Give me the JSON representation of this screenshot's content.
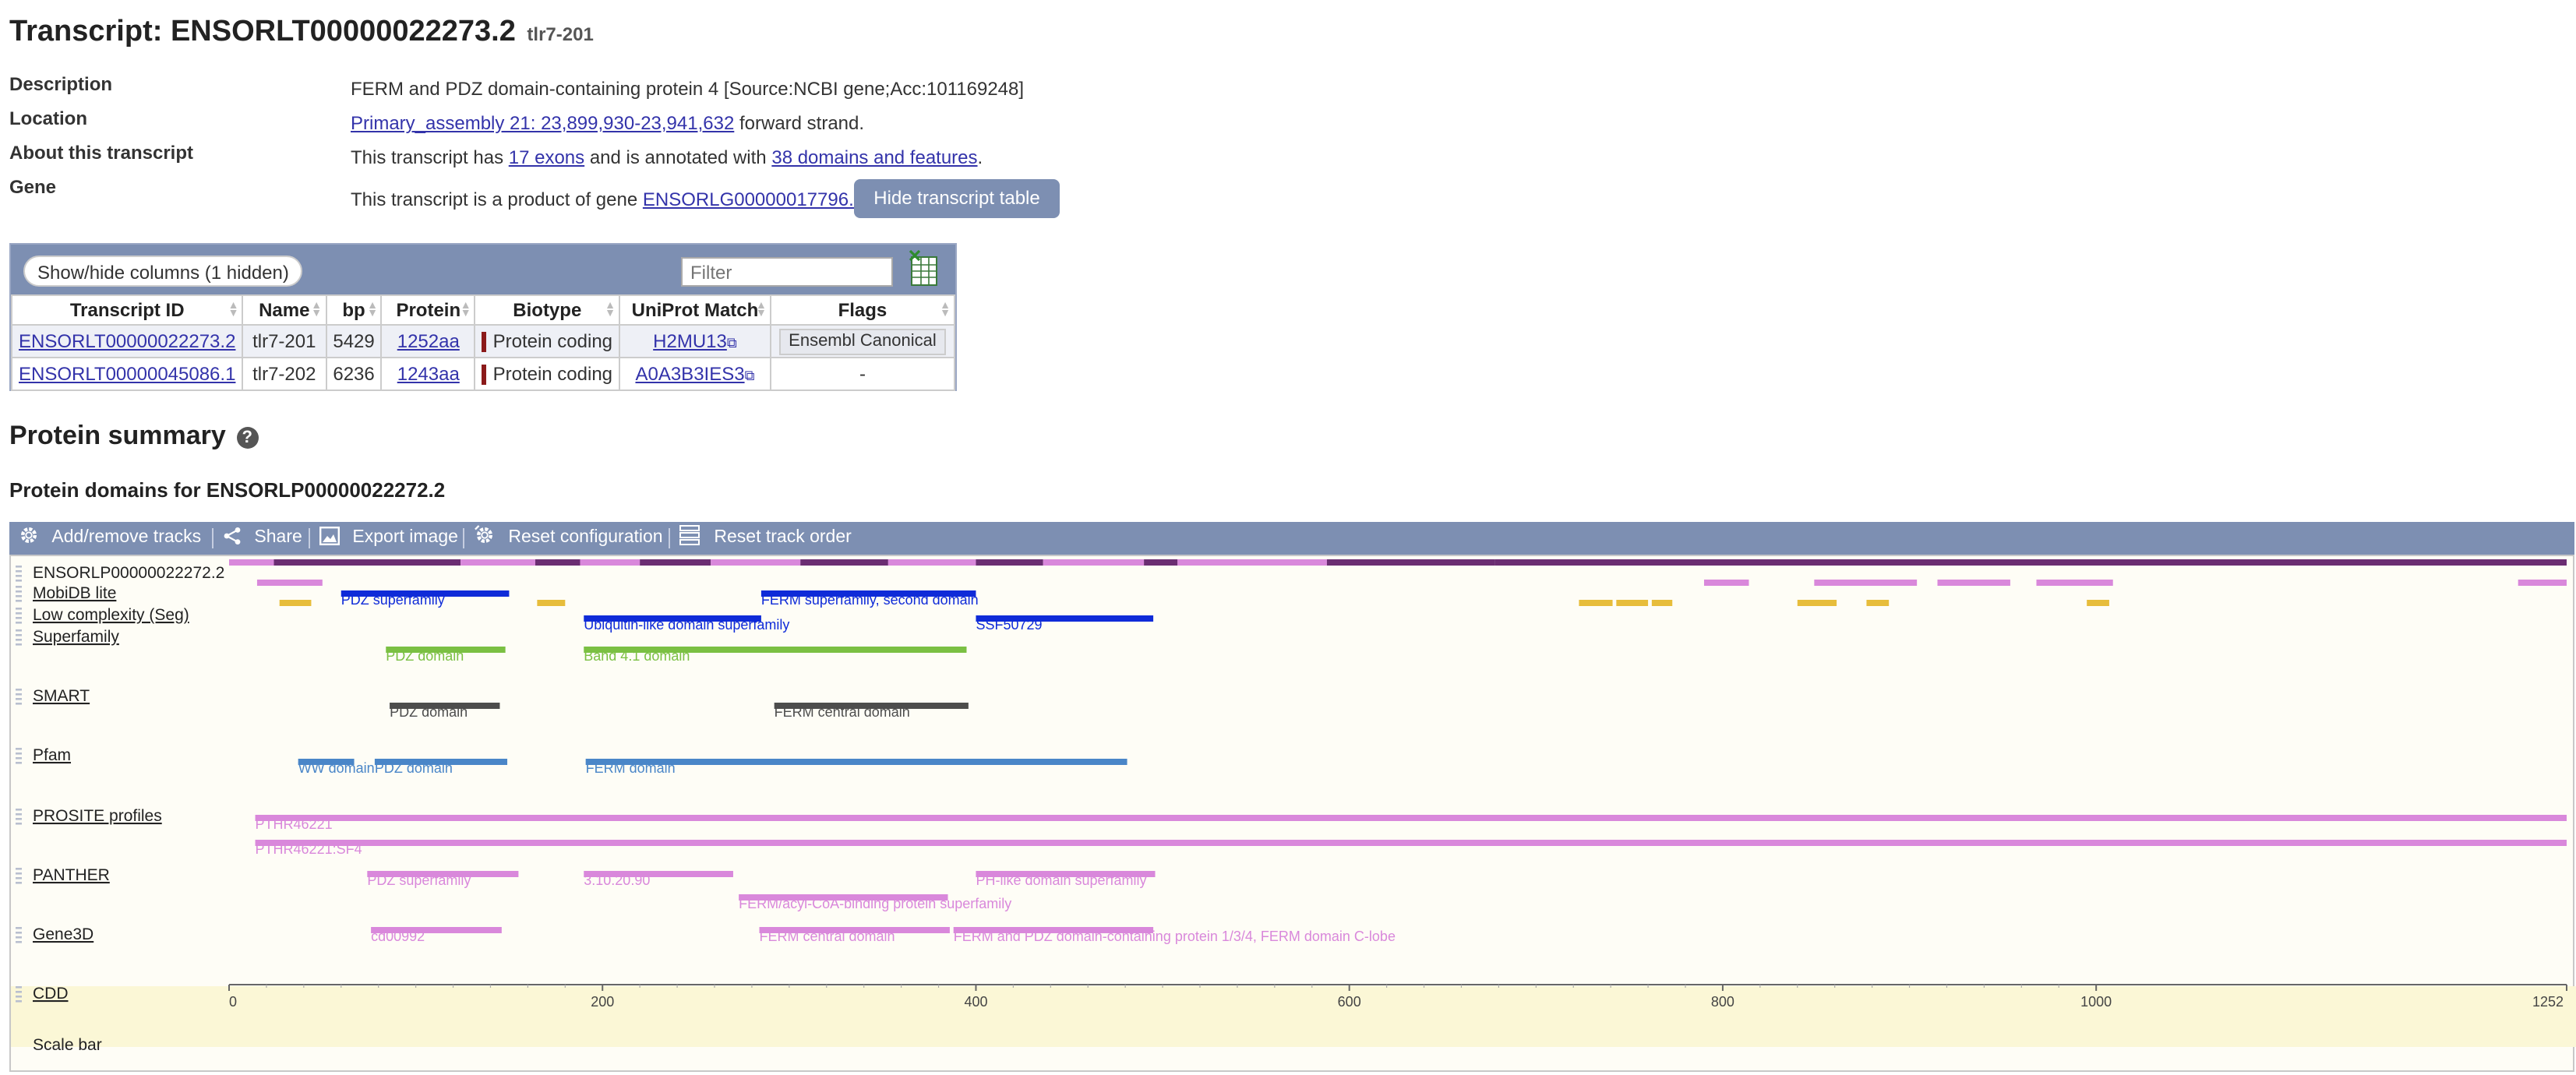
{
  "header": {
    "title": "Transcript: ENSORLT00000022273.2",
    "subtitle": "tlr7-201"
  },
  "summary": {
    "description_label": "Description",
    "description_value": "FERM and PDZ domain-containing protein 4 [Source:NCBI gene;Acc:101169248]",
    "location_label": "Location",
    "location_link": "Primary_assembly 21: 23,899,930-23,941,632",
    "location_suffix": " forward strand.",
    "about_label": "About this transcript",
    "about_prefix": "This transcript has ",
    "about_exons_link": "17 exons",
    "about_middle": " and is annotated with ",
    "about_domains_link": "38 domains and features",
    "about_suffix": ".",
    "gene_label": "Gene",
    "gene_prefix": "This transcript is a product of gene ",
    "gene_link": "ENSORLG00000017796.2",
    "hide_table_button": "Hide transcript table"
  },
  "transcript_table": {
    "show_hide_columns": "Show/hide columns (1 hidden)",
    "filter_placeholder": "Filter",
    "excel_icon": "excel-export-icon",
    "columns": [
      "Transcript ID",
      "Name",
      "bp",
      "Protein",
      "Biotype",
      "UniProt Match",
      "Flags"
    ],
    "rows": [
      {
        "id": "ENSORLT00000022273.2",
        "name": "tlr7-201",
        "bp": "5429",
        "protein": "1252aa",
        "biotype": "Protein coding",
        "uniprot": "H2MU13",
        "flags": "Ensembl Canonical"
      },
      {
        "id": "ENSORLT00000045086.1",
        "name": "tlr7-202",
        "bp": "6236",
        "protein": "1243aa",
        "biotype": "Protein coding",
        "uniprot": "A0A3B3IES3",
        "flags": "-"
      }
    ],
    "colors": {
      "biotype_bar": "#8b1a1a",
      "header_bar": "#7d8fb2"
    }
  },
  "protein_summary": {
    "title": "Protein summary",
    "help_icon": "help-icon",
    "domains_title": "Protein domains for ENSORLP00000022272.2"
  },
  "image_toolbar": {
    "add_remove": "Add/remove tracks",
    "share": "Share",
    "export": "Export image",
    "reset_config": "Reset configuration",
    "reset_order": "Reset track order"
  },
  "tracks": {
    "protein_length": 1252,
    "tracks": [
      {
        "label": "ENSORLP00000022272.2",
        "features": []
      },
      {
        "label": "MobiDB lite",
        "features": []
      },
      {
        "label": "Low complexity (Seg)",
        "features": []
      },
      {
        "label": "Superfamily",
        "features": [
          {
            "name": "PDZ superfamily",
            "start": 60,
            "end": 150
          },
          {
            "name": "FERM superfamily, second domain",
            "start": 285,
            "end": 400
          },
          {
            "name": "Ubiquitin-like domain superfamily",
            "start": 190,
            "end": 285
          },
          {
            "name": "SSF50729",
            "start": 400,
            "end": 495
          }
        ]
      },
      {
        "label": "SMART",
        "features": [
          {
            "name": "PDZ domain",
            "start": 84,
            "end": 148
          },
          {
            "name": "Band 4.1 domain",
            "start": 190,
            "end": 395
          }
        ]
      },
      {
        "label": "Pfam",
        "features": [
          {
            "name": "PDZ domain",
            "start": 86,
            "end": 145
          },
          {
            "name": "FERM central domain",
            "start": 292,
            "end": 396
          }
        ]
      },
      {
        "label": "PROSITE profiles",
        "features": [
          {
            "name": "WW domain",
            "start": 37,
            "end": 67
          },
          {
            "name": "PDZ domain",
            "start": 78,
            "end": 149
          },
          {
            "name": "FERM domain",
            "start": 191,
            "end": 481
          }
        ]
      },
      {
        "label": "PANTHER",
        "features": [
          {
            "name": "PTHR46221",
            "start": 14,
            "end": 1252
          },
          {
            "name": "PTHR46221:SF4",
            "start": 14,
            "end": 1252
          }
        ]
      },
      {
        "label": "Gene3D",
        "features": [
          {
            "name": "PDZ superfamily",
            "start": 74,
            "end": 155
          },
          {
            "name": "3.10.20.90",
            "start": 190,
            "end": 270
          },
          {
            "name": "PH-like domain superfamily",
            "start": 400,
            "end": 496
          },
          {
            "name": "FERM/acyl-CoA-binding protein superfamily",
            "start": 273,
            "end": 385
          }
        ]
      },
      {
        "label": "CDD",
        "features": [
          {
            "name": "cd00992",
            "start": 76,
            "end": 146
          },
          {
            "name": "FERM central domain",
            "start": 284,
            "end": 386
          },
          {
            "name": "FERM and PDZ domain-containing protein 1/3/4, FERM domain C-lobe",
            "start": 388,
            "end": 495
          }
        ]
      },
      {
        "label": "Scale bar",
        "features": []
      }
    ],
    "scale_ticks": [
      "0",
      "200",
      "400",
      "600",
      "800",
      "1000",
      "1252"
    ],
    "colors": {
      "protein_light": "#d988db",
      "protein_dark": "#6b2d72",
      "mobidb": "#d988db",
      "seg": "#e7bd3b",
      "superfamily": "#0f2bd8",
      "smart": "#7bc043",
      "pfam": "#4d4d4d",
      "prosite": "#4a86c8",
      "panther": "#d988db",
      "gene3d": "#d988db",
      "cdd": "#d988db",
      "cdd_band": "#fbf7d6"
    }
  }
}
